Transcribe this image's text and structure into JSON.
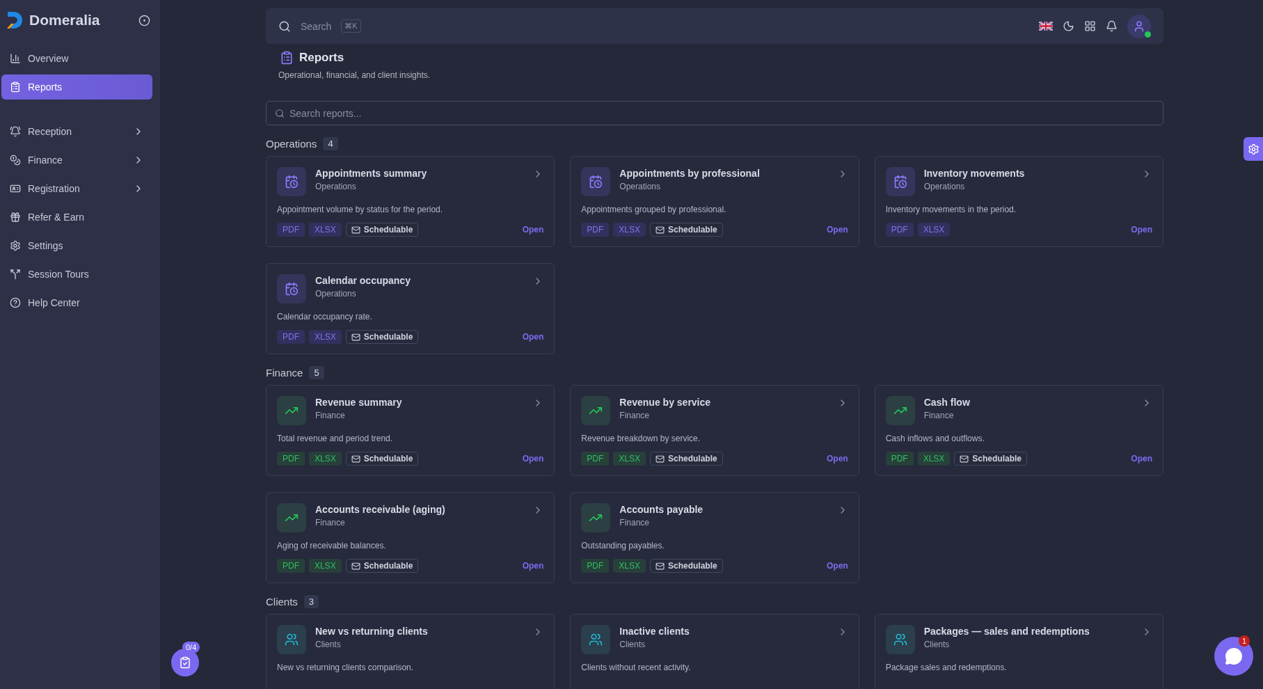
{
  "sidebar": {
    "brand": "Domeralia",
    "items": [
      {
        "label": "Overview",
        "kind": "link",
        "selected": false
      },
      {
        "label": "Reports",
        "kind": "link",
        "selected": true
      },
      {
        "label": "Reception",
        "kind": "group",
        "selected": false
      },
      {
        "label": "Finance",
        "kind": "group",
        "selected": false
      },
      {
        "label": "Registration",
        "kind": "group",
        "selected": false
      },
      {
        "label": "Refer & Earn",
        "kind": "link",
        "selected": false
      },
      {
        "label": "Settings",
        "kind": "link",
        "selected": false
      },
      {
        "label": "Session Tours",
        "kind": "link",
        "selected": false
      },
      {
        "label": "Help Center",
        "kind": "link",
        "selected": false
      }
    ]
  },
  "topbar": {
    "search": {
      "placeholder": "Search",
      "shortcut": "⌘K"
    },
    "user": {
      "online": true
    }
  },
  "page": {
    "title": "Reports",
    "subtitle": "Operational, financial, and client insights."
  },
  "report_search": {
    "placeholder": "Search reports..."
  },
  "sections": [
    {
      "title": "Operations",
      "count": "4",
      "kind": "operations",
      "reports": [
        {
          "title": "Appointments summary",
          "category": "Operations",
          "description": "Appointment volume by status for the period.",
          "formats": [
            "PDF",
            "XLSX"
          ],
          "schedule_tag": "Schedulable",
          "action": "Open"
        },
        {
          "title": "Appointments by professional",
          "category": "Operations",
          "description": "Appointments grouped by professional.",
          "formats": [
            "PDF",
            "XLSX"
          ],
          "schedule_tag": "Schedulable",
          "action": "Open"
        },
        {
          "title": "Inventory movements",
          "category": "Operations",
          "description": "Inventory movements in the period.",
          "formats": [
            "PDF",
            "XLSX"
          ],
          "action": "Open"
        },
        {
          "title": "Calendar occupancy",
          "category": "Operations",
          "description": "Calendar occupancy rate.",
          "formats": [
            "PDF",
            "XLSX"
          ],
          "schedule_tag": "Schedulable",
          "action": "Open"
        }
      ]
    },
    {
      "title": "Finance",
      "count": "5",
      "kind": "finance",
      "reports": [
        {
          "title": "Revenue summary",
          "category": "Finance",
          "description": "Total revenue and period trend.",
          "formats": [
            "PDF",
            "XLSX"
          ],
          "schedule_tag": "Schedulable",
          "action": "Open"
        },
        {
          "title": "Revenue by service",
          "category": "Finance",
          "description": "Revenue breakdown by service.",
          "formats": [
            "PDF",
            "XLSX"
          ],
          "schedule_tag": "Schedulable",
          "action": "Open"
        },
        {
          "title": "Cash flow",
          "category": "Finance",
          "description": "Cash inflows and outflows.",
          "formats": [
            "PDF",
            "XLSX"
          ],
          "schedule_tag": "Schedulable",
          "action": "Open"
        },
        {
          "title": "Accounts receivable (aging)",
          "category": "Finance",
          "description": "Aging of receivable balances.",
          "formats": [
            "PDF",
            "XLSX"
          ],
          "schedule_tag": "Schedulable",
          "action": "Open"
        },
        {
          "title": "Accounts payable",
          "category": "Finance",
          "description": "Outstanding payables.",
          "formats": [
            "PDF",
            "XLSX"
          ],
          "schedule_tag": "Schedulable",
          "action": "Open"
        }
      ]
    },
    {
      "title": "Clients",
      "count": "3",
      "kind": "clients",
      "reports": [
        {
          "title": "New vs returning clients",
          "category": "Clients",
          "description": "New vs returning clients comparison."
        },
        {
          "title": "Inactive clients",
          "category": "Clients",
          "description": "Clients without recent activity."
        },
        {
          "title": "Packages — sales and redemptions",
          "category": "Clients",
          "description": "Package sales and redemptions."
        }
      ]
    }
  ],
  "tour_button": {
    "progress": "0/4"
  },
  "chat_button": {
    "unread": "1"
  }
}
